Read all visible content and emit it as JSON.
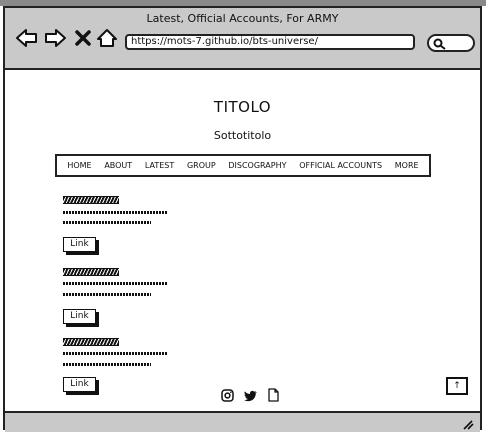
{
  "browser": {
    "window_title": "Latest, Official Accounts, For ARMY",
    "url": "https://mots-7.github.io/bts-universe/",
    "icons": [
      "back-arrow-icon",
      "forward-arrow-icon",
      "close-icon",
      "home-icon",
      "search-icon"
    ]
  },
  "header": {
    "title": "TITOLO",
    "subtitle": "Sottotitolo"
  },
  "nav": {
    "items": [
      "HOME",
      "ABOUT",
      "LATEST",
      "GROUP",
      "DISCOGRAPHY",
      "OFFICIAL ACCOUNTS",
      "MORE"
    ]
  },
  "posts": [
    {
      "link_label": "Link"
    },
    {
      "link_label": "Link"
    },
    {
      "link_label": "Link"
    }
  ],
  "footer": {
    "icons": [
      "instagram-icon",
      "twitter-icon",
      "document-icon"
    ],
    "to_top_label": "↑"
  }
}
